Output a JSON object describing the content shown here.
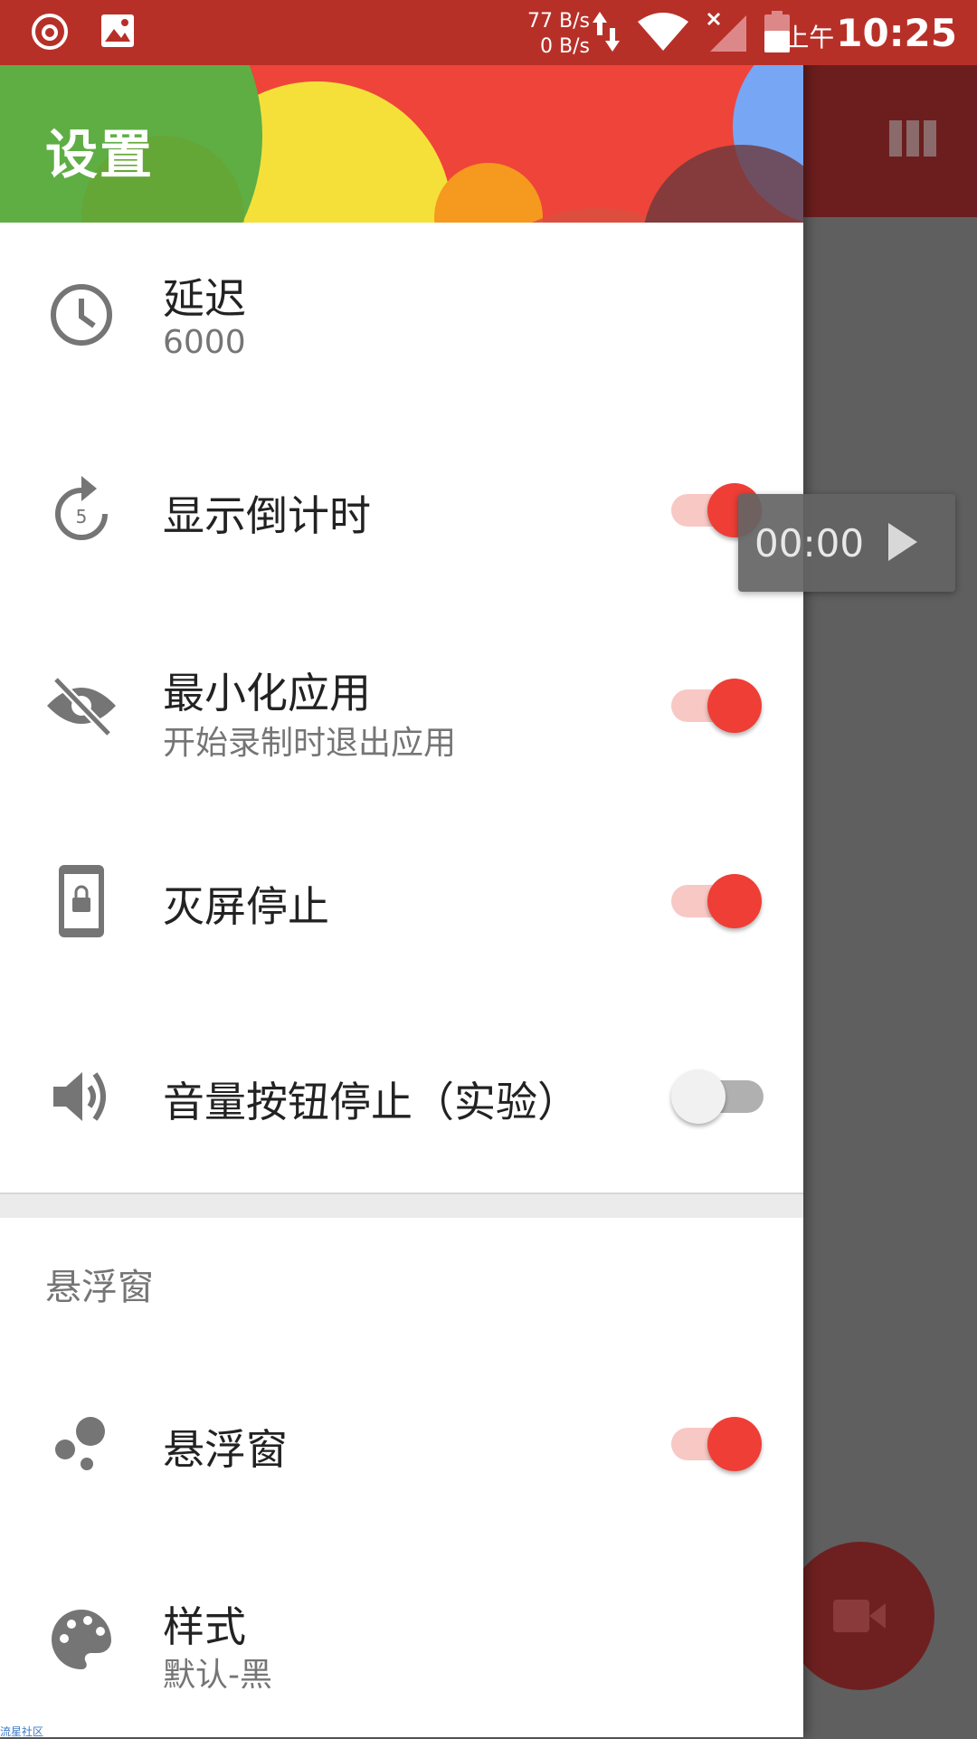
{
  "status_bar": {
    "speed_up": "77 B/s",
    "speed_down": "0 B/s",
    "ampm": "上午",
    "time": "10:25"
  },
  "drawer": {
    "title": "设置"
  },
  "settings": [
    {
      "label": "延迟",
      "sub": "6000",
      "icon": "clock-icon"
    },
    {
      "label": "显示倒计时",
      "icon": "countdown-5-icon",
      "toggle": true
    },
    {
      "label": "最小化应用",
      "sub": "开始录制时退出应用",
      "icon": "eye-off-icon",
      "toggle": true
    },
    {
      "label": "灭屏停止",
      "icon": "phone-lock-icon",
      "toggle": true
    },
    {
      "label": "音量按钮停止（实验）",
      "icon": "volume-icon",
      "toggle": false
    }
  ],
  "section": {
    "title": "悬浮窗"
  },
  "section_items": [
    {
      "label": "悬浮窗",
      "icon": "bubbles-icon",
      "toggle": true
    },
    {
      "label": "样式",
      "sub": "默认-黑",
      "icon": "palette-icon"
    }
  ],
  "float_timer": {
    "time": "00:00"
  },
  "watermark": "流星社区",
  "colors": {
    "accent": "#ee3e36",
    "status_bar": "#b73028"
  }
}
